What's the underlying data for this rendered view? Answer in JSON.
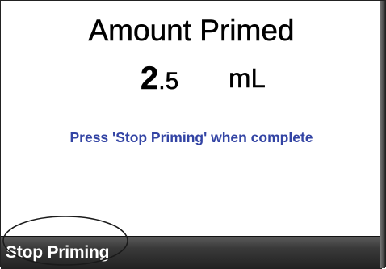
{
  "screen": {
    "title": "Amount Primed",
    "amount": {
      "integer": "2",
      "fraction": ".5",
      "unit": "mL"
    },
    "instruction": "Press 'Stop Priming' when complete"
  },
  "softkeys": {
    "left_label": "Stop Priming"
  },
  "colors": {
    "instruction_text": "#3344a4",
    "softkey_bar": "#2b2b2b"
  }
}
